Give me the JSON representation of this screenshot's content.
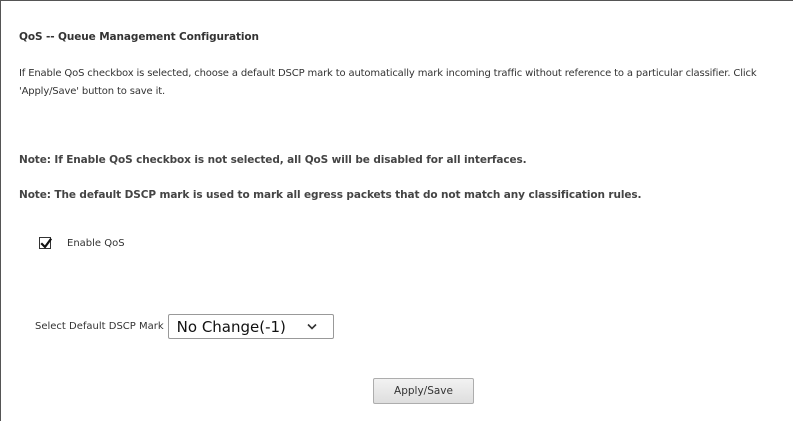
{
  "page": {
    "title": "QoS -- Queue Management Configuration",
    "description": "If Enable QoS checkbox is selected, choose a default DSCP mark to automatically mark incoming traffic without reference to a particular classifier. Click 'Apply/Save' button to save it.",
    "note1": "Note: If Enable QoS checkbox is not selected, all QoS will be disabled for all interfaces.",
    "note2": "Note: The default DSCP mark is used to mark all egress packets that do not match any classification rules."
  },
  "enable_qos": {
    "label": "Enable QoS",
    "checked": true,
    "icon": "checkmark-icon"
  },
  "dscp": {
    "label": "Select Default DSCP Mark",
    "selected": "No Change(-1)",
    "icon": "chevron-down-icon"
  },
  "actions": {
    "apply_label": "Apply/Save"
  },
  "colors": {
    "text": "#333333",
    "border": "#555555",
    "button_bg": "#e6e6e6"
  }
}
